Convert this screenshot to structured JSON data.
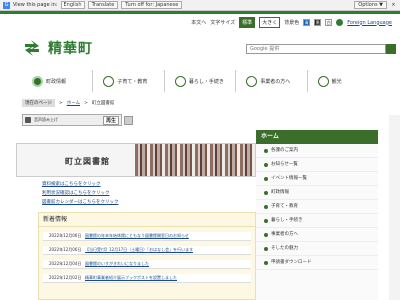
{
  "translate_bar": {
    "message": "View this page in:",
    "language": "English",
    "translate_label": "Translate",
    "turn_off_label": "Turn off for: Japanese",
    "options_label": "Options ▼",
    "close_symbol": "×"
  },
  "header": {
    "home_link": "本文へ",
    "font_size_label": "文字サイズ",
    "font_standard": "標準",
    "font_large": "大きく",
    "color_label": "背景色",
    "color_options": [
      "青",
      "黒",
      "白"
    ],
    "foreign_language": "Foreign Language",
    "site_name": "精華町",
    "search_placeholder": "Google 提供"
  },
  "global_nav": [
    {
      "label": "町政情報",
      "icon": "town-hall-icon"
    },
    {
      "label": "子育て・教育",
      "icon": "child-icon"
    },
    {
      "label": "暮らし・手続き",
      "icon": "house-icon"
    },
    {
      "label": "事業者の方へ",
      "icon": "building-icon"
    },
    {
      "label": "観光",
      "icon": "sightseeing-icon"
    }
  ],
  "breadcrumb": {
    "tag": "現在のページ",
    "items": [
      "ホーム",
      "町立図書館"
    ]
  },
  "readspeaker": {
    "label": "音声読み上げ",
    "button": "再生"
  },
  "banner": {
    "title": "町立図書館"
  },
  "main_links": [
    "資料検索はこちらをクリック",
    "利用状況確認はこちらをクリック",
    "図書館カレンダーはこちらをクリック"
  ],
  "news": {
    "heading": "新着情報",
    "items": [
      {
        "date": "2022年12月06日",
        "title": "図書館の年末年始休館にともなう図書館開室日のお知らせ"
      },
      {
        "date": "2022年12月06日",
        "title": "【当日受付】12月17日（土曜日）「おはなし会」を行います"
      },
      {
        "date": "2022年12月04日",
        "title": "図書館のいすがきれいになりました"
      },
      {
        "date": "2022年12月02日",
        "title": "精華町事業者紹介展示ブックポストを設置しました"
      }
    ]
  },
  "sidebar": {
    "heading": "ホーム",
    "items": [
      "各課のご案内",
      "お知らせ一覧",
      "イベント情報一覧",
      "町政情報",
      "子育て・教育",
      "暮らし・手続き",
      "事業者の方へ",
      "そしたの魅力",
      "申請書ダウンロード"
    ]
  }
}
